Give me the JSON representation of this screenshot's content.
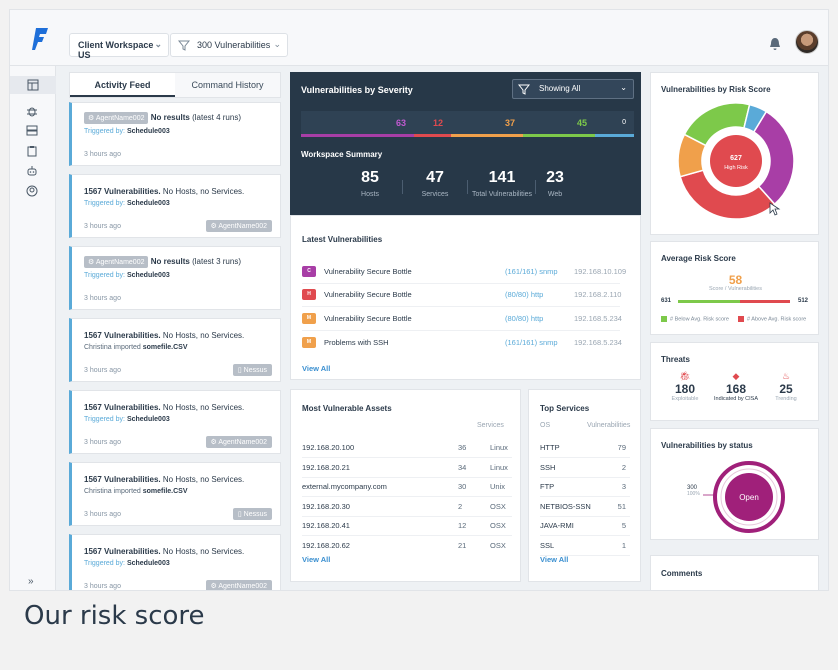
{
  "header": {
    "workspace": "Client Workspace US",
    "filter": "300 Vulnerabilities"
  },
  "sidebar": {
    "items": [
      {
        "icon": "dashboard-icon"
      },
      {
        "icon": "bug-icon"
      },
      {
        "icon": "server-icon"
      },
      {
        "icon": "clipboard-icon"
      },
      {
        "icon": "robot-icon"
      },
      {
        "icon": "user-circle-icon"
      }
    ],
    "expand": "»"
  },
  "feed": {
    "tabs": [
      "Activity Feed",
      "Command History"
    ],
    "cards": [
      {
        "chip": "⚙ AgentName002",
        "bold": "No results",
        "rest": "(latest 4 runs)",
        "sub_pre": "Triggered by:",
        "sub_link": "Schedule003",
        "time": "3 hours ago",
        "tag": ""
      },
      {
        "chip": "",
        "bold": "1567 Vulnerabilities.",
        "rest": "No Hosts, no Services.",
        "sub_pre": "Triggered by:",
        "sub_link": "Schedule003",
        "time": "3 hours ago",
        "tag": "⚙ AgentName002"
      },
      {
        "chip": "⚙ AgentName002",
        "bold": "No results",
        "rest": "(latest 3 runs)",
        "sub_pre": "Triggered by:",
        "sub_link": "Schedule003",
        "time": "3 hours ago",
        "tag": ""
      },
      {
        "chip": "",
        "bold": "1567 Vulnerabilities.",
        "rest": "No Hosts, no Services.",
        "sub_pre": "Christina imported",
        "sub_link": "somefile.CSV",
        "time": "3 hours ago",
        "tag": "▯ Nessus"
      },
      {
        "chip": "",
        "bold": "1567 Vulnerabilities.",
        "rest": "No Hosts, no Services.",
        "sub_pre": "Triggered by:",
        "sub_link": "Schedule003",
        "time": "3 hours ago",
        "tag": "⚙ AgentName002"
      },
      {
        "chip": "",
        "bold": "1567 Vulnerabilities.",
        "rest": "No Hosts, no Services.",
        "sub_pre": "Christina imported",
        "sub_link": "somefile.CSV",
        "time": "3 hours ago",
        "tag": "▯ Nessus"
      },
      {
        "chip": "",
        "bold": "1567 Vulnerabilities.",
        "rest": "No Hosts, no Services.",
        "sub_pre": "Triggered by:",
        "sub_link": "Schedule003",
        "time": "3 hours ago",
        "tag": "⚙ AgentName002"
      }
    ]
  },
  "severity": {
    "title": "Vulnerabilities by Severity",
    "showing": "Showing All",
    "segments": [
      {
        "value": "63",
        "color": "#a83ea6"
      },
      {
        "value": "12",
        "color": "#e04a4f"
      },
      {
        "value": "37",
        "color": "#f0a04b"
      },
      {
        "value": "45",
        "color": "#7dc94a"
      },
      {
        "value": "0",
        "color": "#5aaad8"
      }
    ]
  },
  "workspace_summary": {
    "title": "Workspace Summary",
    "stats": [
      {
        "n": "85",
        "l": "Hosts"
      },
      {
        "n": "47",
        "l": "Services"
      },
      {
        "n": "141",
        "l": "Total Vulnerabilities"
      },
      {
        "n": "23",
        "l": "Web"
      }
    ]
  },
  "latest": {
    "title": "Latest Vulnerabilities",
    "rows": [
      {
        "badge": "C",
        "color": "#a83ea6",
        "name": "Vulnerability Secure Bottle",
        "port": "(161/161) snmp",
        "ip": "192.168.10.109"
      },
      {
        "badge": "H",
        "color": "#e04a4f",
        "name": "Vulnerability Secure Bottle",
        "port": "(80/80) http",
        "ip": "192.168.2.110"
      },
      {
        "badge": "M",
        "color": "#f0a04b",
        "name": "Vulnerability Secure Bottle",
        "port": "(80/80) http",
        "ip": "192.168.5.234"
      },
      {
        "badge": "M",
        "color": "#f0a04b",
        "name": "Problems with SSH",
        "port": "(161/161) snmp",
        "ip": "192.168.5.234"
      }
    ],
    "view_all": "View All"
  },
  "assets": {
    "title": "Most Vulnerable Assets",
    "col": "Services",
    "rows": [
      {
        "host": "192.168.20.100",
        "count": "36",
        "os": "Linux"
      },
      {
        "host": "192.168.20.21",
        "count": "34",
        "os": "Linux"
      },
      {
        "host": "external.mycompany.com",
        "count": "30",
        "os": "Unix"
      },
      {
        "host": "192.168.20.30",
        "count": "2",
        "os": "OSX"
      },
      {
        "host": "192.168.20.41",
        "count": "12",
        "os": "OSX"
      },
      {
        "host": "192.168.20.62",
        "count": "21",
        "os": "OSX"
      }
    ],
    "view_all": "View All"
  },
  "services": {
    "title": "Top Services",
    "col1": "OS",
    "col2": "Vulnerabilities",
    "rows": [
      {
        "name": "HTTP",
        "v": "79"
      },
      {
        "name": "SSH",
        "v": "2"
      },
      {
        "name": "FTP",
        "v": "3"
      },
      {
        "name": "NETBIOS-SSN",
        "v": "51"
      },
      {
        "name": "JAVA-RMI",
        "v": "5"
      },
      {
        "name": "SSL",
        "v": "1"
      }
    ],
    "view_all": "View All"
  },
  "risk": {
    "title": "Vulnerabilities by Risk Score",
    "center_value": "627",
    "center_label": "High Risk",
    "legend": [
      {
        "v": "576",
        "color": "#a83ea6"
      },
      {
        "v": "627",
        "color": "#e04a4f"
      },
      {
        "v": "232",
        "color": "#f0a04b"
      },
      {
        "v": "412",
        "color": "#7dc94a"
      },
      {
        "v": "97",
        "color": "#5aaad8"
      }
    ]
  },
  "avg": {
    "title": "Average Risk Score",
    "value": "58",
    "sub": "Score / Vulnerabilities",
    "left": "631",
    "right": "512",
    "below_fraction": 0.55,
    "leg_below": "# Below Avg. Risk score",
    "leg_above": "# Above Avg. Risk score"
  },
  "threats": {
    "title": "Threats",
    "items": [
      {
        "n": "180",
        "l": "Exploitable",
        "icon": "bug-icon",
        "color": "#e04a4f",
        "lcolor": "#9aa6b2"
      },
      {
        "n": "168",
        "l": "Indicated by CISA",
        "icon": "diamond-icon",
        "color": "#e04a4f",
        "lcolor": "#2b3a4a"
      },
      {
        "n": "25",
        "l": "Trending",
        "icon": "flame-icon",
        "color": "#e04a4f",
        "lcolor": "#9aa6b2"
      }
    ]
  },
  "status": {
    "title": "Vulnerabilities by status",
    "count": "300",
    "pct": "100%",
    "label": "Open"
  },
  "comments": {
    "title": "Comments"
  },
  "caption": "Our risk score"
}
